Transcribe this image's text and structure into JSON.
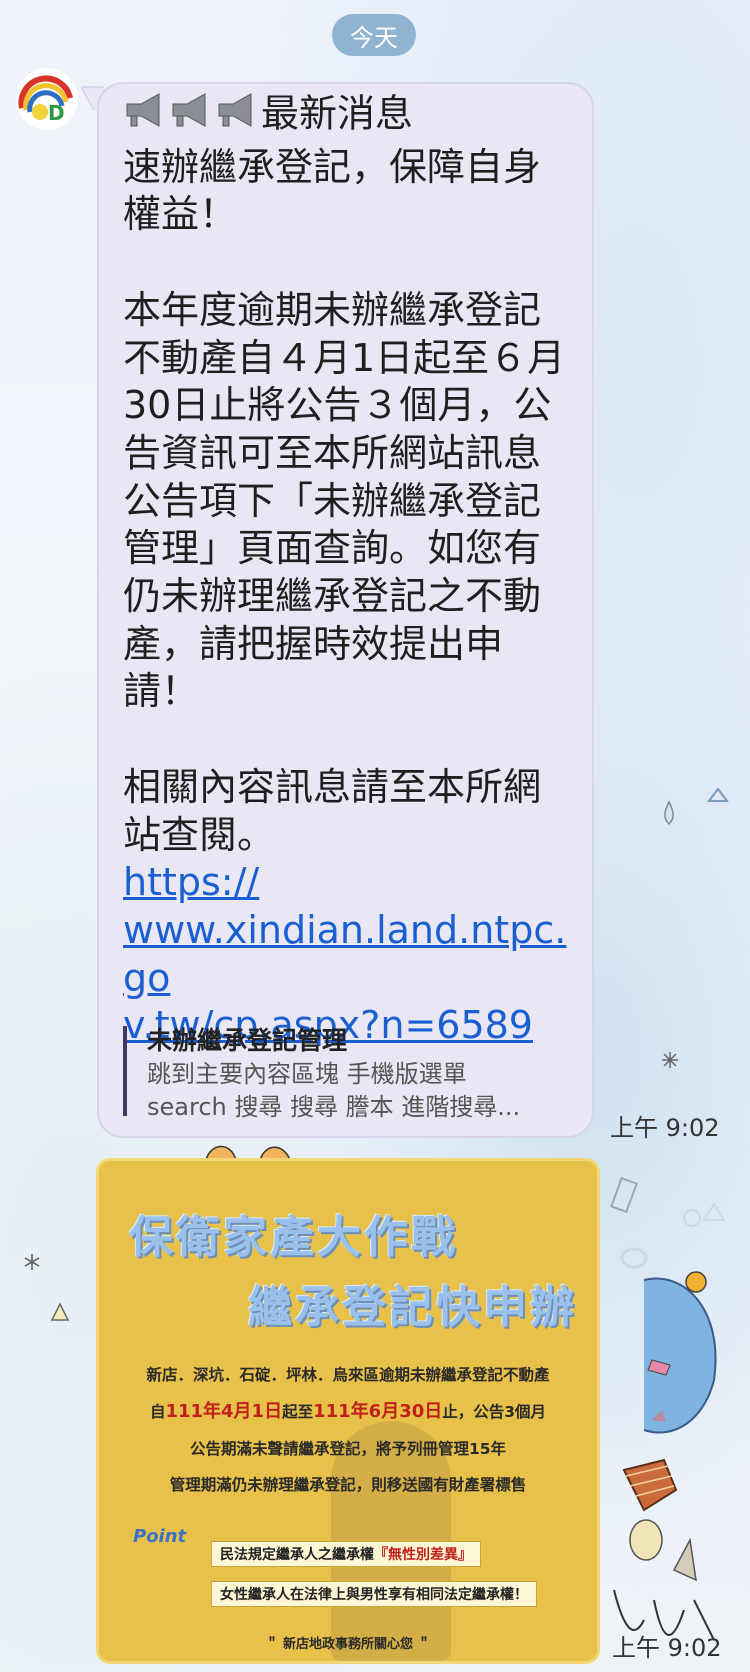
{
  "date_label": "今天",
  "message": {
    "headline": "最新消息",
    "line_subject": "速辦繼承登記，保障自身權益！",
    "paragraph_1": "本年度逾期未辦繼承登記不動產自４月1日起至６月30日止將公告３個月，公告資訊可至本所網站訊息公告項下「未辦繼承登記管理」頁面查詢。如您有仍未辦理繼承登記之不動產，請把握時效提出申請！",
    "paragraph_2": "相關內容訊息請至本所網站查閱。",
    "link_url": "https://www.xindian.land.ntpc.gov.tw/cp.aspx?n=6589",
    "link_line_1": "https://",
    "link_line_2": "www.xindian.land.ntpc.go",
    "link_line_3": "v.tw/cp.aspx?n=6589",
    "preview_title": "未辦繼承登記管理",
    "preview_desc_1": "跳到主要內容區塊 手機版選單",
    "preview_desc_2": "search 搜尋 搜尋 謄本 進階搜尋...",
    "time": "上午 9:02"
  },
  "image_message": {
    "title_1": "保衛家產大作戰",
    "title_2": "繼承登記快申辦",
    "line_1": "新店．深坑．石碇．坪林．烏來區逾期未辦繼承登記不動產",
    "line_2_a": "自",
    "line_2_b": "111年4月1日",
    "line_2_c": "起至",
    "line_2_d": "111年6月30日",
    "line_2_e": "止，公告3個月",
    "line_3": "公告期滿未聲請繼承登記，將予列冊管理15年",
    "line_4": "管理期滿仍未辦理繼承登記，則移送國有財產署標售",
    "point_label": "Point",
    "note_1_a": "民法規定繼承人之繼承權",
    "note_1_b": "『無性別差異』",
    "note_2": "女性繼承人在法律上與男性享有相同法定繼承權！",
    "footer": "＂ 新店地政事務所關心您 ＂",
    "time": "上午 9:02"
  },
  "colors": {
    "bubble": "#e9e7f4",
    "link": "#1a5fd1",
    "date_pill": "#8fb3d0",
    "poster": "#e7c14a"
  }
}
